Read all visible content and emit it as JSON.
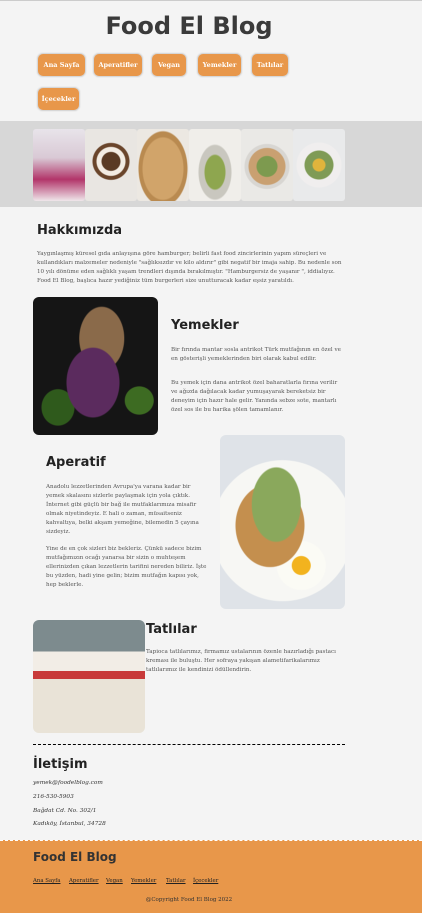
{
  "header": {
    "title": "Food El Blog",
    "nav": [
      "Ana Sayfa",
      "Aperatifler",
      "Vegan",
      "Yemekler",
      "Tatlılar",
      "İçecekler"
    ]
  },
  "gallery": {
    "images": [
      "dessert-photo",
      "roll-cake-photo",
      "tart-photo",
      "pear-salad-photo",
      "bowl-dish-photo",
      "salad-photo"
    ]
  },
  "about": {
    "title": "Hakkımızda",
    "text": "Yaygınlaşmış küresel gıda anlayışına göre hamburger; belirli fast food zincirlerinin yapım süreçleri ve kullandıkları malzemeler nedeniyle \"sağlıksızdır ve kilo aldırır\" gibi negatif bir imaja sahip. Bu nedenle son 10 yılı dönüme eden sağlıklı yaşam trendleri dışında bırakılmıştır. \"Hamburgersiz de yaşanır \", iddialıyız. Food El Blog, başlıca hazır yediğiniz tüm burgerleri size unutturacak kadar eşsiz yaratıldı."
  },
  "yemekler": {
    "title": "Yemekler",
    "p1": "Bir fırında mantar sosla antrikot Türk mutfağının en özel ve en gösterişli yemeklerinden biri olarak kabul edilir.",
    "p2": "Bu yemek için dana antrikot özel baharatlarla fırına verilir ve ağızda dağılacak kadar yumuşayarak bereketsiz bir deneyim için hazır hale gelir. Yanında sebze sote, mantarlı özel sos ile bu harika şölen tamamlanır."
  },
  "aperatif": {
    "title": "Aperatif",
    "p1": "Anadolu lezzetlerinden Avrupa'ya varana kadar bir yemek skalasını sizlerle paylaşmak için yola çıktık. İnternet gibi güçlü bir bağ ile mutfaklarımıza misafir olmak niyetindeyiz. E hali o zaman, müsaitseniz kahvaltıya, belki akşam yemeğine, bilemedin 5 çayına sizdeyiz.",
    "p2": "Yine de en çok sizleri biz bekleriz. Çünkü sadece bizim mutfağımızın ocağı yanarsa bir sizin o muhteşem ellerinizden çıkan lezzetlerin tarifini nereden biliriz. İşte bu yüzden, hadi yine gelin; bizim mutfağın kapısı yok, hep beklerle."
  },
  "tatlilar": {
    "title": "Tatlılar",
    "p1": "Tapioca tatlılarımız, firmamız ustalarının özenle hazırladığı pastacı kreması ile buluştu. Her sofraya yakışan alametifarikalarımız tatlılarımız ile kendinizi ödüllendirin."
  },
  "contact": {
    "title": "İletişim",
    "email": "yemek@foodelblog.com",
    "phone": "216-530-5903",
    "address1": "Bağdat Cd. No. 302/1",
    "address2": "Kadıköy, İstanbul, 34728"
  },
  "footer": {
    "title": "Food El Blog",
    "links": [
      "Ana Sayfa",
      "Aperatifler",
      "Vegan",
      "Yemekler",
      "Tatlılar",
      "İçecekler"
    ],
    "copyright": "@Copyright Food El Blog 2022"
  },
  "colors": {
    "accent": "#e8974a",
    "band": "#d7d7d7",
    "background": "#f4f4f4"
  }
}
